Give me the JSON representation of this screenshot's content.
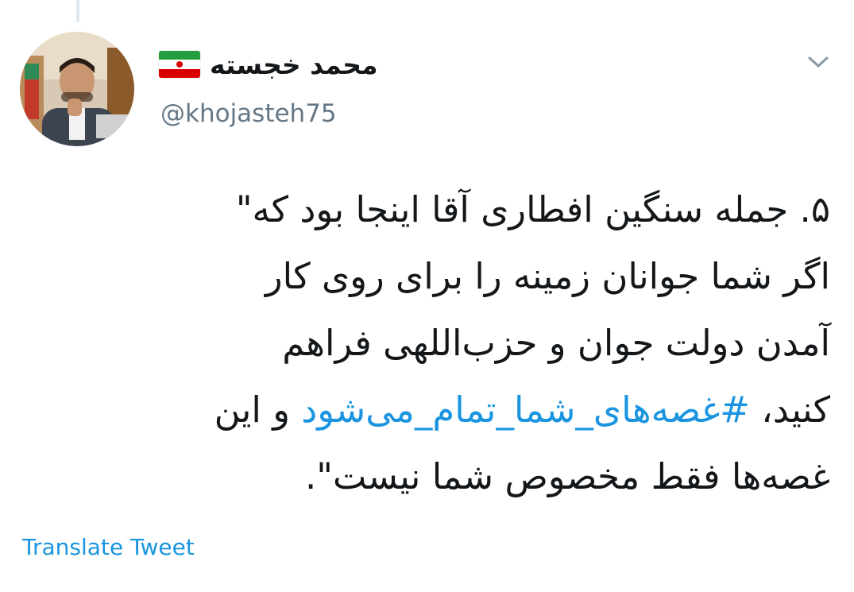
{
  "user": {
    "display_name": "محمد خجسته",
    "handle": "@khojasteh75",
    "flag_icon": "iran-flag-icon"
  },
  "tweet": {
    "line1": "۵. جمله سنگین افطاری آقا اینجا بود که\"",
    "line2": "اگر شما جوانان زمینه را برای روی کار",
    "line3": "آمدن دولت جوان و حزب‌اللهی فراهم",
    "line4_before": "کنید، ",
    "hashtag": "#غصه‌های_شما_تمام_می‌شود",
    "line4_after": " و این",
    "line5": "غصه‌ها فقط مخصوص شما نیست\"."
  },
  "actions": {
    "translate_label": "Translate Tweet"
  },
  "colors": {
    "link": "#1b95e0",
    "text": "#14171a",
    "secondary": "#657786"
  }
}
